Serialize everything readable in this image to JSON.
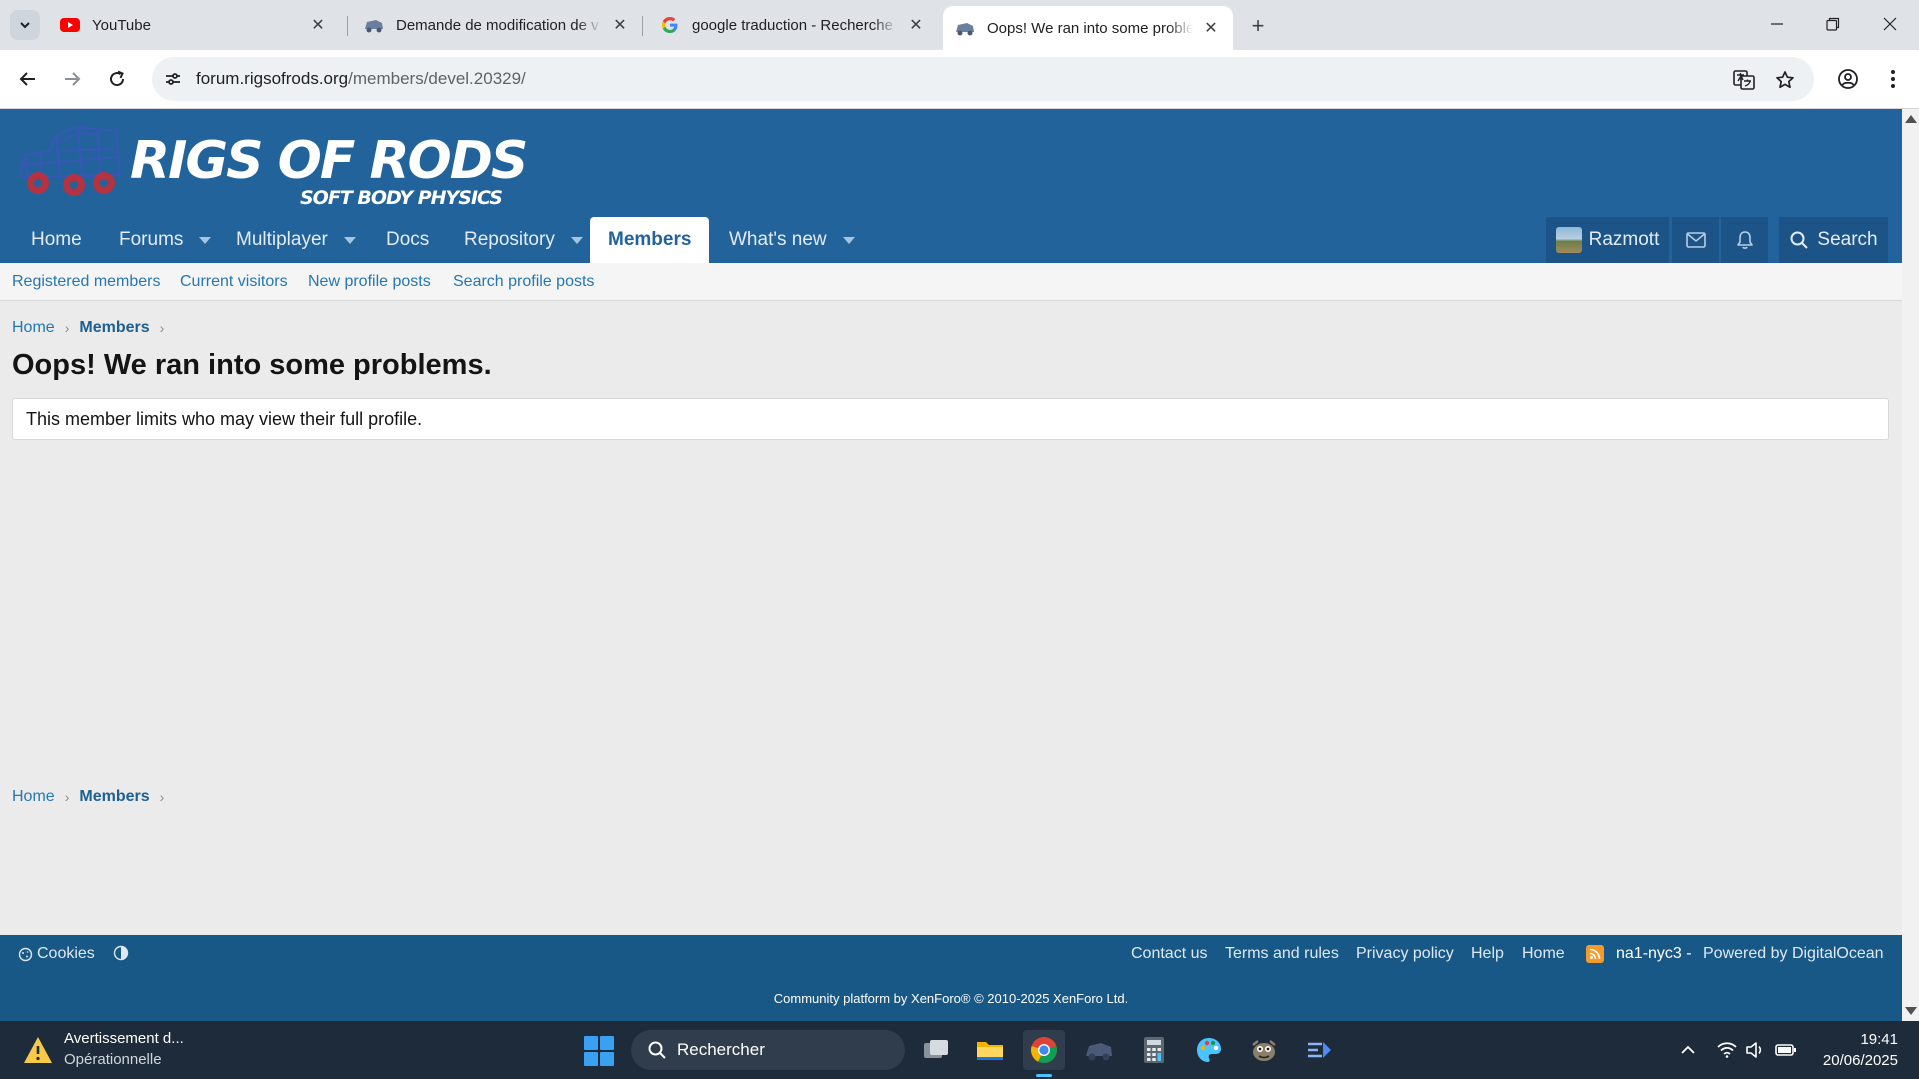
{
  "browser": {
    "tabs": [
      {
        "title": "YouTube",
        "favicon": "youtube-icon"
      },
      {
        "title": "Demande de modification de v",
        "favicon": "rigs-of-rods-icon"
      },
      {
        "title": "google traduction - Recherche (",
        "favicon": "google-icon"
      },
      {
        "title": "Oops! We ran into some proble",
        "favicon": "rigs-of-rods-icon",
        "active": true
      }
    ],
    "url_domain": "forum.rigsofrods.org",
    "url_path": "/members/devel.20329/"
  },
  "site": {
    "logo_title": "RIGS OF RODS",
    "logo_subtitle": "SOFT BODY PHYSICS",
    "nav": [
      {
        "label": "Home",
        "has_dropdown": false
      },
      {
        "label": "Forums",
        "has_dropdown": true
      },
      {
        "label": "Multiplayer",
        "has_dropdown": true
      },
      {
        "label": "Docs",
        "has_dropdown": false
      },
      {
        "label": "Repository",
        "has_dropdown": true
      },
      {
        "label": "Members",
        "has_dropdown": false,
        "selected": true
      },
      {
        "label": "What's new",
        "has_dropdown": true
      }
    ],
    "user": {
      "name": "Razmott"
    },
    "search_label": "Search",
    "subnav": [
      "Registered members",
      "Current visitors",
      "New profile posts",
      "Search profile posts"
    ],
    "colors": {
      "header": "#22639b",
      "link": "#2577b1",
      "footer": "#185886"
    }
  },
  "breadcrumb": {
    "home": "Home",
    "members": "Members"
  },
  "error": {
    "title": "Oops! We ran into some problems.",
    "message": "This member limits who may view their full profile."
  },
  "footer": {
    "cookies": "Cookies",
    "links": [
      "Contact us",
      "Terms and rules",
      "Privacy policy",
      "Help",
      "Home"
    ],
    "server": "na1-nyc3 -",
    "powered": "Powered by DigitalOcean",
    "copyright": "Community platform by XenForo® © 2010-2025 XenForo Ltd."
  },
  "taskbar": {
    "warning_title": "Avertissement d...",
    "warning_subtitle": "Opérationnelle",
    "search_placeholder": "Rechercher",
    "time": "19:41",
    "date": "20/06/2025"
  }
}
